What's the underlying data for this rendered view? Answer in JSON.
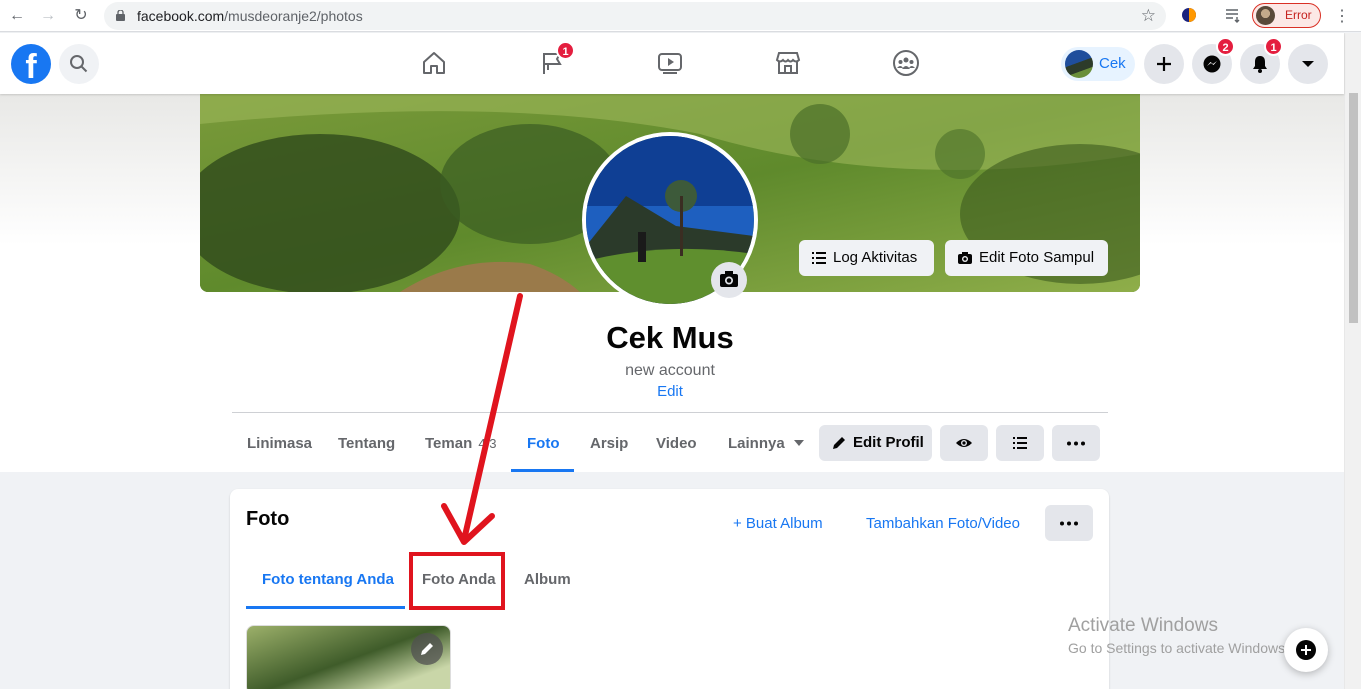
{
  "browser": {
    "url_host": "facebook.com",
    "url_path": "/musdeoranje2/photos",
    "profile_status": "Error"
  },
  "header": {
    "logo_letter": "f",
    "pages_badge": "1",
    "messenger_badge": "2",
    "notifications_badge": "1",
    "me_label": "Cek"
  },
  "profile": {
    "name": "Cek Mus",
    "bio": "new account",
    "edit_label": "Edit",
    "log_activity_label": "Log Aktivitas",
    "edit_cover_label": "Edit Foto Sampul"
  },
  "profile_tabs": [
    {
      "label": "Linimasa"
    },
    {
      "label": "Tentang"
    },
    {
      "label": "Teman",
      "count": "4 3"
    },
    {
      "label": "Foto"
    },
    {
      "label": "Arsip"
    },
    {
      "label": "Video"
    },
    {
      "label": "Lainnya"
    }
  ],
  "profile_actions": {
    "edit_profile_label": "Edit Profil"
  },
  "photos_card": {
    "title": "Foto",
    "create_album_label": "+ Buat Album",
    "add_photo_label": "Tambahkan Foto/Video",
    "tabs": [
      {
        "label": "Foto tentang Anda"
      },
      {
        "label": "Foto Anda"
      },
      {
        "label": "Album"
      }
    ]
  },
  "watermark": {
    "line1": "Activate Windows",
    "line2": "Go to Settings to activate Windows."
  },
  "colors": {
    "fb_blue": "#1877f2",
    "annotation_red": "#e0141e",
    "badge_red": "#e41e3f"
  }
}
